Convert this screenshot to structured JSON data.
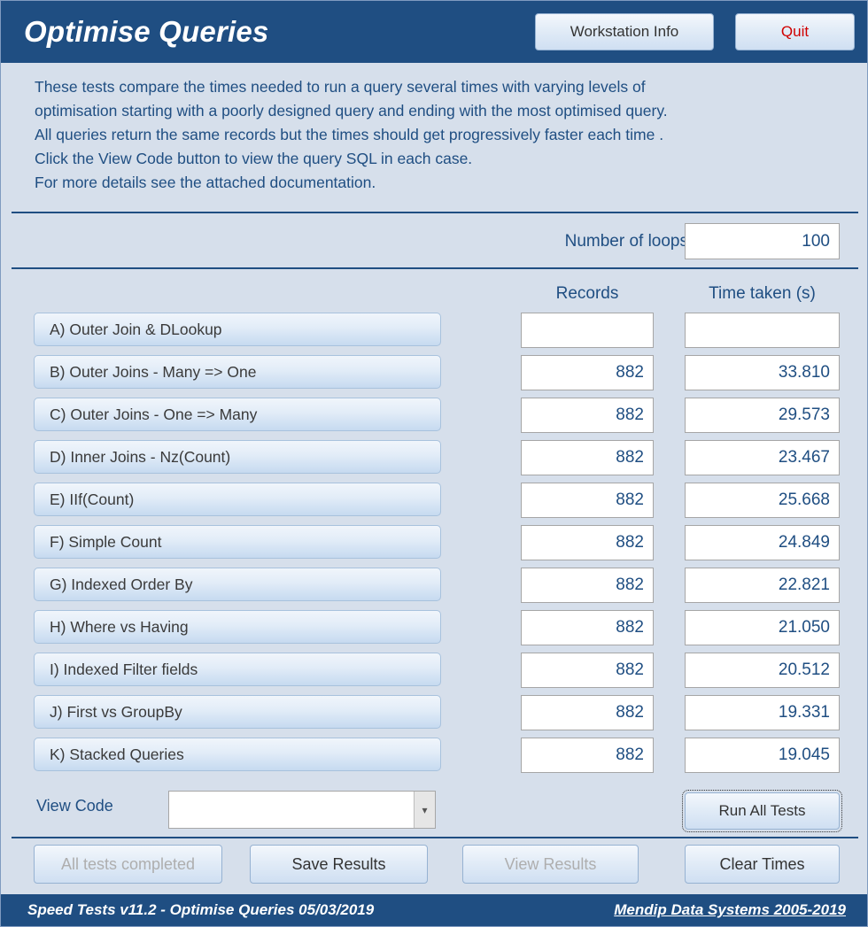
{
  "header": {
    "title": "Optimise Queries",
    "workstation_button": "Workstation Info",
    "quit_button": "Quit",
    "quit_color": "#d00000",
    "bar_color": "#1f4e82"
  },
  "description": {
    "lines": [
      "These tests compare the times needed to run a query several times with varying levels of",
      "optimisation starting with a poorly designed query and ending with the most optimised query.",
      "All queries return the same records but the times should get progressively faster each time .",
      "Click the View Code button to view the query SQL in each case.",
      "For more details see the attached documentation."
    ]
  },
  "loops": {
    "label": "Number of loops",
    "value": "100"
  },
  "table": {
    "columns": [
      "Records",
      "Time taken (s)"
    ],
    "rows": [
      {
        "label": "A)  Outer Join & DLookup",
        "records": "",
        "time": ""
      },
      {
        "label": "B)  Outer Joins - Many => One",
        "records": "882",
        "time": "33.810"
      },
      {
        "label": "C)  Outer Joins - One => Many",
        "records": "882",
        "time": "29.573"
      },
      {
        "label": "D)  Inner Joins - Nz(Count)",
        "records": "882",
        "time": "23.467"
      },
      {
        "label": "E)   IIf(Count)",
        "records": "882",
        "time": "25.668"
      },
      {
        "label": "F)   Simple Count",
        "records": "882",
        "time": "24.849"
      },
      {
        "label": "G)  Indexed Order By",
        "records": "882",
        "time": "22.821"
      },
      {
        "label": "H)  Where vs Having",
        "records": "882",
        "time": "21.050"
      },
      {
        "label": "I)   Indexed Filter fields",
        "records": "882",
        "time": "20.512"
      },
      {
        "label": "J)  First vs GroupBy",
        "records": "882",
        "time": "19.331"
      },
      {
        "label": "K)  Stacked Queries",
        "records": "882",
        "time": "19.045"
      }
    ]
  },
  "viewcode": {
    "label": "View Code",
    "selected": "",
    "arrow_icon": "chevron-down-icon"
  },
  "run_all": {
    "label": "Run All Tests"
  },
  "bottom_buttons": [
    {
      "label": "All tests completed",
      "disabled": true
    },
    {
      "label": "Save Results",
      "disabled": false
    },
    {
      "label": "View Results",
      "disabled": true
    },
    {
      "label": "Clear Times",
      "disabled": false
    }
  ],
  "footer": {
    "left": "Speed Tests v11.2 - Optimise Queries   05/03/2019",
    "right": "Mendip Data Systems 2005-2019"
  }
}
